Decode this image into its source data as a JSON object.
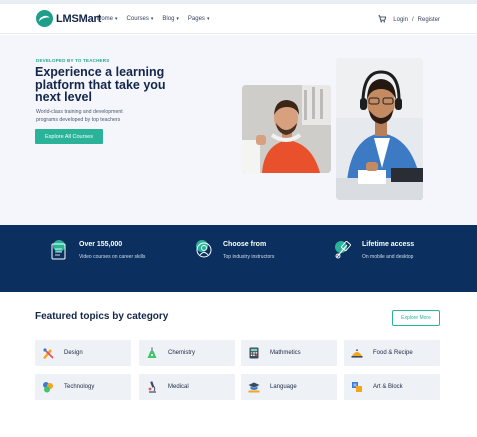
{
  "brand": {
    "name": "LMSMart"
  },
  "nav": {
    "menu": [
      {
        "label": "Home"
      },
      {
        "label": "Courses"
      },
      {
        "label": "Blog"
      },
      {
        "label": "Pages"
      }
    ],
    "login": "Login",
    "separator": "/",
    "register": "Register"
  },
  "hero": {
    "tag": "DEVELOPED BY TO TEACHERS",
    "title": "Experience a learning platform that take you next level",
    "subtitle": "World-class training and development programs developed by top teachers",
    "button": "Explore All Courses"
  },
  "stats": [
    {
      "title": "Over 155,000",
      "desc": "Video courses on career skills",
      "icon": "video-book-icon"
    },
    {
      "title": "Choose from",
      "desc": "Top industry instructors",
      "icon": "instructor-icon"
    },
    {
      "title": "Lifetime access",
      "desc": "On mobile and desktop",
      "icon": "access-icon"
    }
  ],
  "featured": {
    "title": "Featured topics by category",
    "explore_more": "Explore More",
    "categories": [
      {
        "label": "Design",
        "icon": "design-icon"
      },
      {
        "label": "Chemistry",
        "icon": "chemistry-icon"
      },
      {
        "label": "Mathmetics",
        "icon": "calculator-icon"
      },
      {
        "label": "Food & Recipe",
        "icon": "food-icon"
      },
      {
        "label": "Technology",
        "icon": "technology-icon"
      },
      {
        "label": "Medical",
        "icon": "microscope-icon"
      },
      {
        "label": "Language",
        "icon": "graduation-cap-icon"
      },
      {
        "label": "Art & Block",
        "icon": "art-blocks-icon"
      }
    ]
  },
  "colors": {
    "accent": "#2bb39a",
    "navy": "#0b2f5e",
    "heading": "#14264a",
    "hero_bg": "#f4f6fb",
    "card_bg": "#eef1f6"
  }
}
